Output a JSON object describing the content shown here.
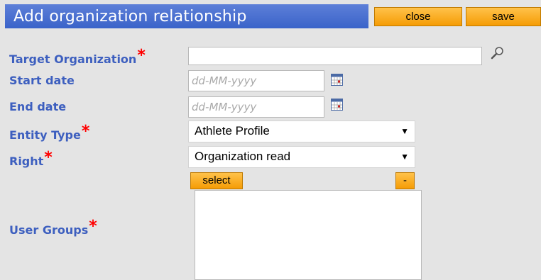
{
  "header": {
    "title": "Add organization relationship",
    "close_label": "close",
    "save_label": "save"
  },
  "form": {
    "target_org": {
      "label": "Target Organization",
      "required_mark": "*",
      "value": ""
    },
    "start_date": {
      "label": "Start date",
      "placeholder": "dd-MM-yyyy"
    },
    "end_date": {
      "label": "End date",
      "placeholder": "dd-MM-yyyy"
    },
    "entity_type": {
      "label": "Entity Type",
      "required_mark": "*",
      "selected": "Athlete Profile"
    },
    "right": {
      "label": "Right",
      "required_mark": "*",
      "selected": "Organization read"
    },
    "user_groups": {
      "label": "User Groups",
      "required_mark": "*",
      "select_label": "select",
      "remove_label": "-",
      "items": []
    }
  }
}
